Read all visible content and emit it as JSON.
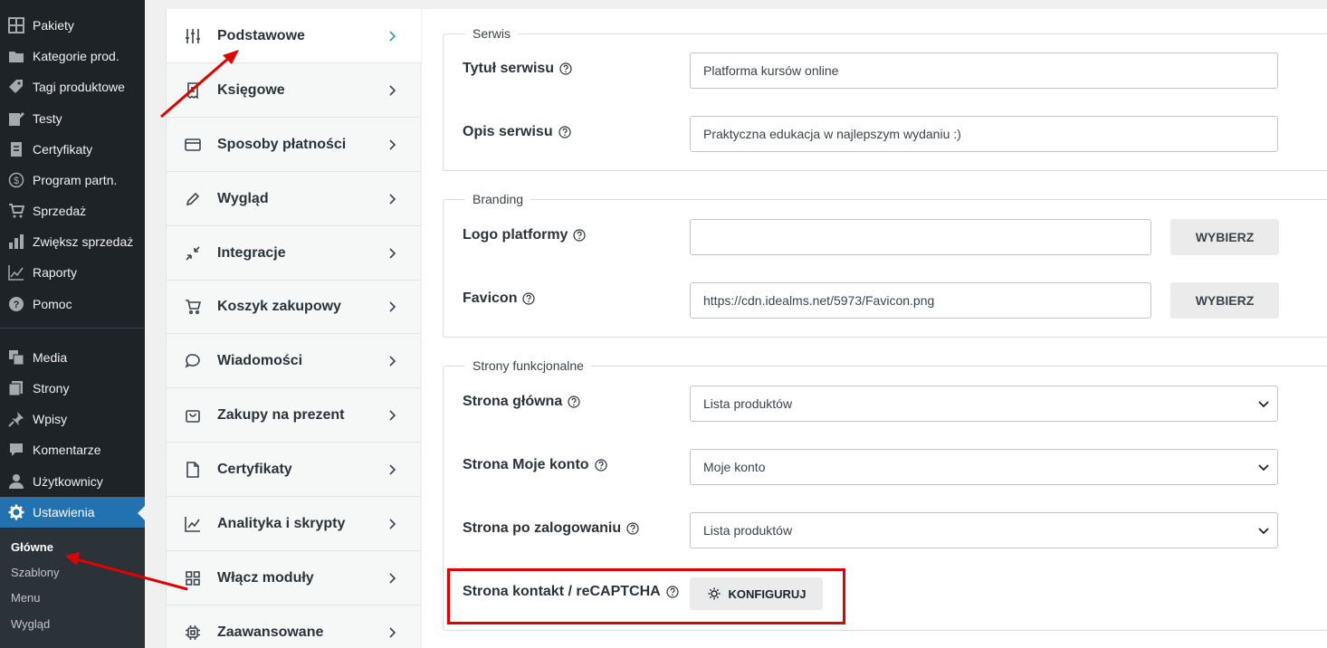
{
  "wp_menu": {
    "items": [
      {
        "label": "Pakiety",
        "icon": "grid-icon"
      },
      {
        "label": "Kategorie prod.",
        "icon": "folder-icon"
      },
      {
        "label": "Tagi produktowe",
        "icon": "tag-icon"
      },
      {
        "label": "Testy",
        "icon": "edit-icon"
      },
      {
        "label": "Certyfikaty",
        "icon": "document-icon"
      },
      {
        "label": "Program partn.",
        "icon": "dollar-icon"
      },
      {
        "label": "Sprzedaż",
        "icon": "cart-icon"
      },
      {
        "label": "Zwiększ sprzedaż",
        "icon": "bar-chart-icon"
      },
      {
        "label": "Raporty",
        "icon": "line-chart-icon"
      },
      {
        "label": "Pomoc",
        "icon": "help-icon"
      },
      {
        "label": "Media",
        "icon": "media-icon"
      },
      {
        "label": "Strony",
        "icon": "pages-icon"
      },
      {
        "label": "Wpisy",
        "icon": "pin-icon"
      },
      {
        "label": "Komentarze",
        "icon": "comment-icon"
      },
      {
        "label": "Użytkownicy",
        "icon": "user-icon"
      },
      {
        "label": "Ustawienia",
        "icon": "settings-icon"
      }
    ],
    "submenu": [
      "Główne",
      "Szablony",
      "Menu",
      "Wygląd"
    ]
  },
  "settings_nav": [
    {
      "label": "Podstawowe",
      "icon": "sliders-icon"
    },
    {
      "label": "Księgowe",
      "icon": "receipt-icon"
    },
    {
      "label": "Sposoby płatności",
      "icon": "credit-card-icon"
    },
    {
      "label": "Wygląd",
      "icon": "pencil-icon"
    },
    {
      "label": "Integracje",
      "icon": "compress-icon"
    },
    {
      "label": "Koszyk zakupowy",
      "icon": "cart-icon"
    },
    {
      "label": "Wiadomości",
      "icon": "message-icon"
    },
    {
      "label": "Zakupy na prezent",
      "icon": "bag-icon"
    },
    {
      "label": "Certyfikaty",
      "icon": "file-icon"
    },
    {
      "label": "Analityka i skrypty",
      "icon": "chart-icon"
    },
    {
      "label": "Włącz moduły",
      "icon": "modules-icon"
    },
    {
      "label": "Zaawansowane",
      "icon": "cpu-icon"
    }
  ],
  "serwis": {
    "legend": "Serwis",
    "title_label": "Tytuł serwisu",
    "title_value": "Platforma kursów online",
    "desc_label": "Opis serwisu",
    "desc_value": "Praktyczna edukacja w najlepszym wydaniu :)"
  },
  "branding": {
    "legend": "Branding",
    "logo_label": "Logo platformy",
    "logo_value": "",
    "favicon_label": "Favicon",
    "favicon_value": "https://cdn.idealms.net/5973/Favicon.png",
    "choose_button": "WYBIERZ"
  },
  "strony": {
    "legend": "Strony funkcjonalne",
    "home_label": "Strona główna",
    "home_value": "Lista produktów",
    "account_label": "Strona Moje konto",
    "account_value": "Moje konto",
    "after_login_label": "Strona po zalogowaniu",
    "after_login_value": "Lista produktów",
    "contact_label": "Strona kontakt / reCAPTCHA",
    "configure_button": "KONFIGURUJ"
  },
  "colors": {
    "wp_sidebar": "#1d2327",
    "wp_active": "#2271b1",
    "annotation": "#e00000",
    "active_chevron": "#2a9d8f"
  }
}
